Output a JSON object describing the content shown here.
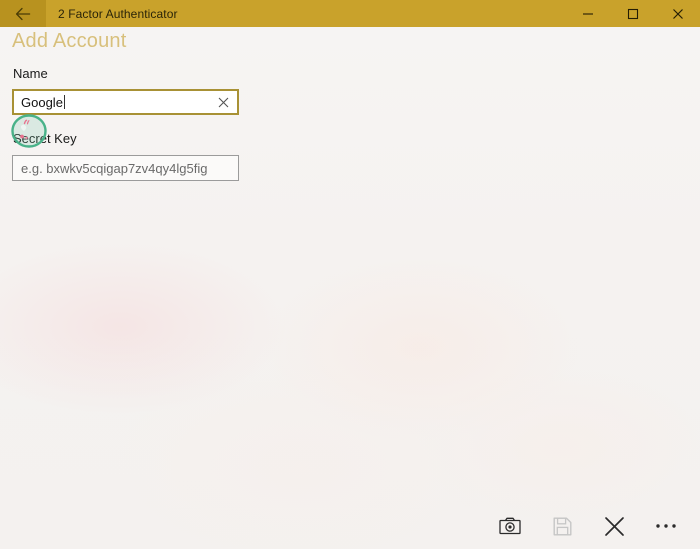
{
  "window": {
    "title": "2 Factor Authenticator",
    "back_icon": "back-arrow-icon",
    "controls": {
      "minimize": "minimize-icon",
      "maximize": "maximize-icon",
      "close": "close-icon"
    },
    "titlebar_color": "#c9a22b",
    "titlebar_accent_color": "#b8921f",
    "title_text_color": "#2a2408"
  },
  "page": {
    "header": "Add Account",
    "header_color": "#d8c07c"
  },
  "form": {
    "name_field": {
      "label": "Name",
      "value": "Google",
      "focused": true,
      "border_color": "#a89135",
      "clear_icon": "clear-x-icon"
    },
    "secret_key_field": {
      "label": "Secret Key",
      "value": "",
      "placeholder": "e.g. bxwkv5cqigap7zv4qy4lg5fig",
      "focused": false,
      "border_color": "#9b9b9b"
    }
  },
  "annotation": {
    "shape": "circle-highlight",
    "color": "#49b289",
    "accent_color": "#e8738f",
    "target": "name-input-left-edge"
  },
  "command_bar": {
    "buttons": [
      {
        "name": "scan-qr-camera-button",
        "icon": "camera-icon",
        "enabled": true
      },
      {
        "name": "save-button",
        "icon": "floppy-disk-save-icon",
        "enabled": false
      },
      {
        "name": "cancel-button",
        "icon": "close-x-icon",
        "enabled": true
      },
      {
        "name": "more-options-button",
        "icon": "ellipsis-icon",
        "enabled": true
      }
    ],
    "enabled_color": "#2b2b2b",
    "disabled_color": "#c6c6c6"
  }
}
